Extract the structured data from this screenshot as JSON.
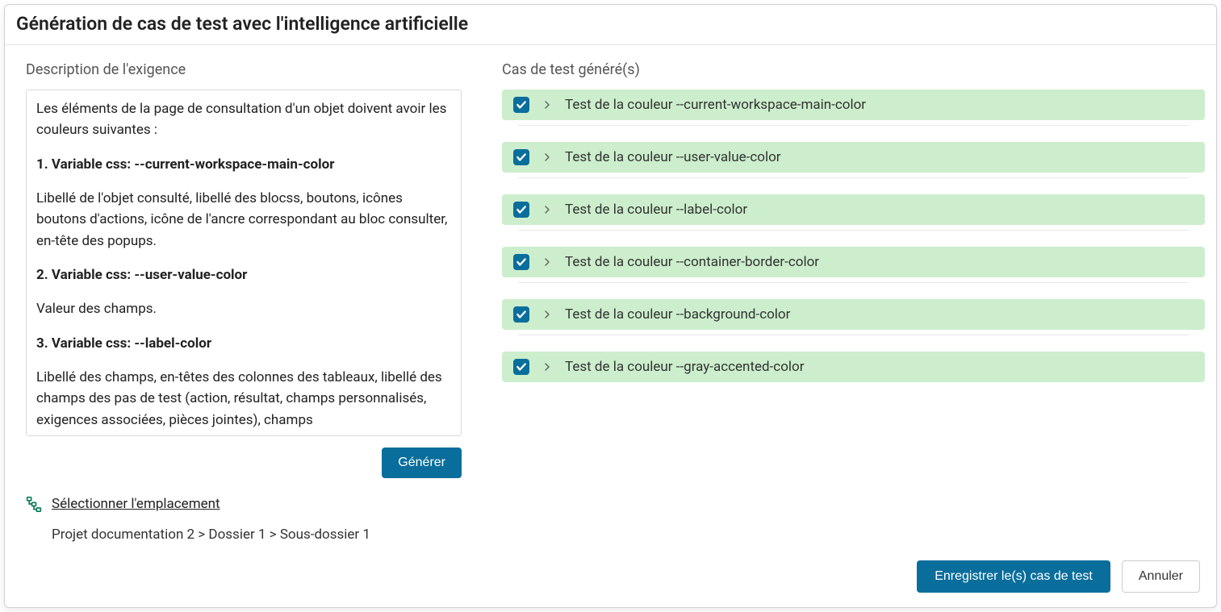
{
  "modal": {
    "title": "Génération de cas de test avec l'intelligence artificielle"
  },
  "left": {
    "section_label": "Description de l'exigence",
    "paragraphs": [
      {
        "text": "Les éléments de la page de consultation d'un objet doivent avoir les couleurs suivantes :",
        "bold": false
      },
      {
        "text": "1. Variable css: --current-workspace-main-color",
        "bold": true
      },
      {
        "text": "Libellé de l'objet consulté,  libellé des blocss, boutons, icônes boutons d'actions, icône de l'ancre correspondant au bloc consulter, en-tête des popups.",
        "bold": false
      },
      {
        "text": "2. Variable css: --user-value-color",
        "bold": true
      },
      {
        "text": "Valeur des champs.",
        "bold": false
      },
      {
        "text": "3. Variable css: --label-color",
        "bold": true
      },
      {
        "text": "Libellé des champs, en-têtes des colonnes des tableaux, libellé des champs des pas de test (action, résultat, champs personnalisés, exigences associées, pièces jointes), champs",
        "bold": false
      }
    ],
    "generate_button": "Générer",
    "location_link": "Sélectionner l'emplacement",
    "breadcrumb": "Projet documentation 2 > Dossier 1 > Sous-dossier 1"
  },
  "right": {
    "section_label": "Cas de test généré(s)",
    "cases": [
      {
        "label": "Test de la couleur --current-workspace-main-color",
        "checked": true
      },
      {
        "label": "Test de la couleur --user-value-color",
        "checked": true
      },
      {
        "label": "Test de la couleur --label-color",
        "checked": true
      },
      {
        "label": "Test de la couleur --container-border-color",
        "checked": true
      },
      {
        "label": "Test de la couleur --background-color",
        "checked": true
      },
      {
        "label": "Test de la couleur --gray-accented-color",
        "checked": true
      }
    ]
  },
  "footer": {
    "save": "Enregistrer le(s) cas de test",
    "cancel": "Annuler"
  }
}
